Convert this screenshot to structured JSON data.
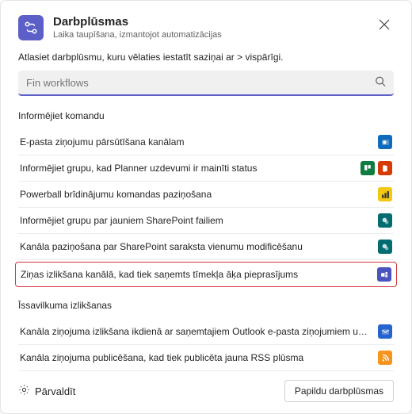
{
  "header": {
    "title": "Darbplūsmas",
    "subtitle": "Laika taupīšana, izmantojot automatizācijas"
  },
  "instruction": "Atlasiet darbplūsmu, kuru vēlaties iestatīt saziņai ar > vispārīgi.",
  "search": {
    "placeholder": "Fin workflows",
    "value": ""
  },
  "sections": [
    {
      "title": "Informējiet komandu",
      "items": [
        {
          "label": "E-pasta ziņojumu pārsūtīšana kanālam",
          "icons": [
            "outlook"
          ]
        },
        {
          "label": "Informējiet grupu, kad Planner uzdevumi ir mainīti status",
          "icons": [
            "planner",
            "office"
          ]
        },
        {
          "label": "Powerball brīdinājumu komandas paziņošana",
          "icons": [
            "pbi"
          ]
        },
        {
          "label": "Informējiet grupu par jauniem SharePoint failiem",
          "icons": [
            "sp"
          ]
        },
        {
          "label": "Kanāla paziņošana par SharePoint saraksta vienumu modificēšanu",
          "icons": [
            "sp"
          ]
        },
        {
          "label": "Ziņas izlikšana kanālā, kad tiek saņemts tīmekļa āķa pieprasījums",
          "icons": [
            "teams"
          ],
          "highlighted": true
        }
      ]
    },
    {
      "title": "Īssavilkuma izlikšanas",
      "items": [
        {
          "label": "Kanāla ziņojuma izlikšana ikdienā ar saņemtajiem Outlook e-pasta ziņojumiem un Teams ziņām",
          "icons": [
            "blue"
          ]
        },
        {
          "label": "Kanāla ziņojuma publicēšana, kad tiek publicēta jauna RSS plūsma",
          "icons": [
            "rss"
          ]
        }
      ]
    }
  ],
  "footer": {
    "manage": "Pārvaldīt",
    "more": "Papildu darbplūsmas"
  },
  "icons": {
    "outlook": "outlook-icon",
    "planner": "planner-icon",
    "office": "office-icon",
    "pbi": "powerbi-icon",
    "sp": "sharepoint-icon",
    "teams": "teams-icon",
    "blue": "outlook-square-icon",
    "rss": "rss-icon"
  }
}
